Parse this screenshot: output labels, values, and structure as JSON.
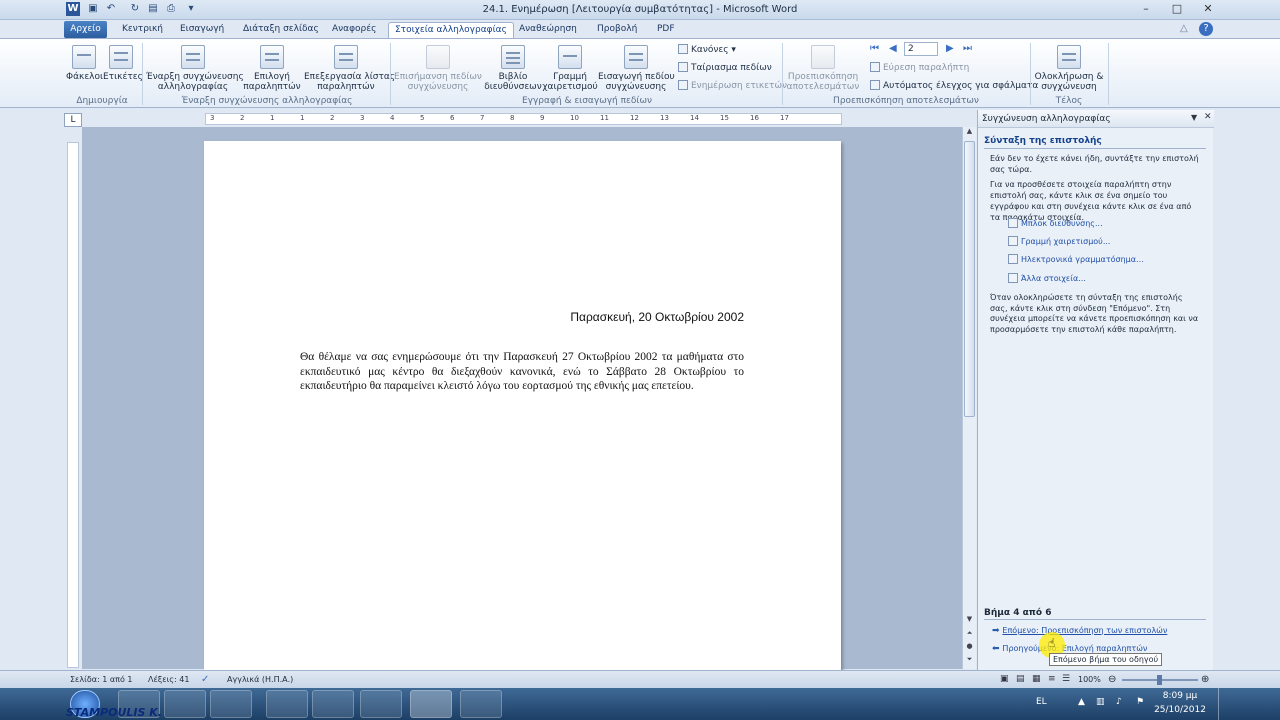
{
  "window": {
    "title": "24.1. Ενημέρωση [Λειτουργία συμβατότητας] - Microsoft Word",
    "minimize_glyph": "–",
    "maximize_glyph": "□",
    "close_glyph": "✕"
  },
  "tabs": [
    {
      "label": "Αρχείο"
    },
    {
      "label": "Κεντρική"
    },
    {
      "label": "Εισαγωγή"
    },
    {
      "label": "Διάταξη σελίδας"
    },
    {
      "label": "Αναφορές"
    },
    {
      "label": "Στοιχεία αλληλογραφίας"
    },
    {
      "label": "Αναθεώρηση"
    },
    {
      "label": "Προβολή"
    },
    {
      "label": "PDF"
    }
  ],
  "ribbon": {
    "create": {
      "envelopes": "Φάκελοι",
      "labels": "Ετικέτες",
      "group_label": "Δημιουργία"
    },
    "start_merge": {
      "start_line1": "Έναρξη συγχώνευσης",
      "start_line2": "αλληλογραφίας",
      "select_line1": "Επιλογή",
      "select_line2": "παραληπτών",
      "edit_line1": "Επεξεργασία λίστας",
      "edit_line2": "παραληπτών",
      "group_label": "Έναρξη συγχώνευσης αλληλογραφίας"
    },
    "write_insert": {
      "highlight_line1": "Επισήμανση πεδίων",
      "highlight_line2": "συγχώνευσης",
      "address_line1": "Βιβλίο",
      "address_line2": "διευθύνσεων",
      "greeting_line1": "Γραμμή",
      "greeting_line2": "χαιρετισμού",
      "insert_line1": "Εισαγωγή πεδίου",
      "insert_line2": "συγχώνευσης",
      "rules": "Κανόνες",
      "match_fields": "Ταίριασμα πεδίων",
      "update_labels": "Ενημέρωση ετικετών",
      "group_label": "Εγγραφή & εισαγωγή πεδίων"
    },
    "preview": {
      "preview_line1": "Προεπισκόπηση",
      "preview_line2": "αποτελεσμάτων",
      "record_number": "2",
      "find_recipient": "Εύρεση παραλήπτη",
      "auto_check": "Αυτόματος έλεγχος για σφάλματα",
      "group_label": "Προεπισκόπηση αποτελεσμάτων"
    },
    "finish": {
      "finish_line1": "Ολοκλήρωση &",
      "finish_line2": "συγχώνευση",
      "group_label": "Τέλος"
    }
  },
  "ruler": {
    "corner": "L",
    "ticks": [
      "3",
      "2",
      "1",
      "1",
      "2",
      "3",
      "4",
      "5",
      "6",
      "7",
      "8",
      "9",
      "10",
      "11",
      "12",
      "13",
      "14",
      "15",
      "16",
      "17"
    ]
  },
  "document": {
    "date": "Παρασκευή, 20 Οκτωβρίου 2002",
    "body": "Θα θέλαμε να σας ενημερώσουμε ότι την Παρασκευή 27 Οκτωβρίου 2002 τα μαθήματα στο εκπαιδευτικό μας κέντρο θα διεξαχθούν κανονικά, ενώ το Σάββατο 28 Οκτωβρίου το εκπαιδευτήριο θα παραμείνει κλειστό λόγω του εορτασμού της εθνικής μας επετείου."
  },
  "taskpane": {
    "title": "Συγχώνευση αλληλογραφίας",
    "heading": "Σύνταξη της επιστολής",
    "p1": "Εάν δεν το έχετε κάνει ήδη, συντάξτε την επιστολή σας τώρα.",
    "p2": "Για να προσθέσετε στοιχεία παραλήπτη στην επιστολή σας, κάντε κλικ σε ένα σημείο του εγγράφου και στη συνέχεια κάντε κλικ σε ένα από τα παρακάτω στοιχεία.",
    "links": [
      "Μπλοκ διεύθυνσης...",
      "Γραμμή χαιρετισμού...",
      "Ηλεκτρονικά γραμματόσημα...",
      "Άλλα στοιχεία..."
    ],
    "p3": "Όταν ολοκληρώσετε τη σύνταξη της επιστολής σας, κάντε κλικ στη σύνδεση \"Επόμενο\". Στη συνέχεια μπορείτε να κάνετε προεπισκόπηση και να προσαρμόσετε την επιστολή κάθε παραλήπτη.",
    "step": "Βήμα 4 από 6",
    "next": "Επόμενο: Προεπισκόπηση των επιστολών",
    "prev": "Προηγούμενο: Επιλογή παραληπτών",
    "tooltip": "Επόμενο βήμα του οδηγού"
  },
  "status": {
    "page": "Σελίδα: 1 από 1",
    "words": "Λέξεις: 41",
    "language": "Αγγλικά (Η.Π.Α.)",
    "zoom": "100%"
  },
  "taskbar": {
    "lang": "EL",
    "time": "8:09 μμ",
    "date": "25/10/2012",
    "watermark": "STAMPOULIS K."
  }
}
